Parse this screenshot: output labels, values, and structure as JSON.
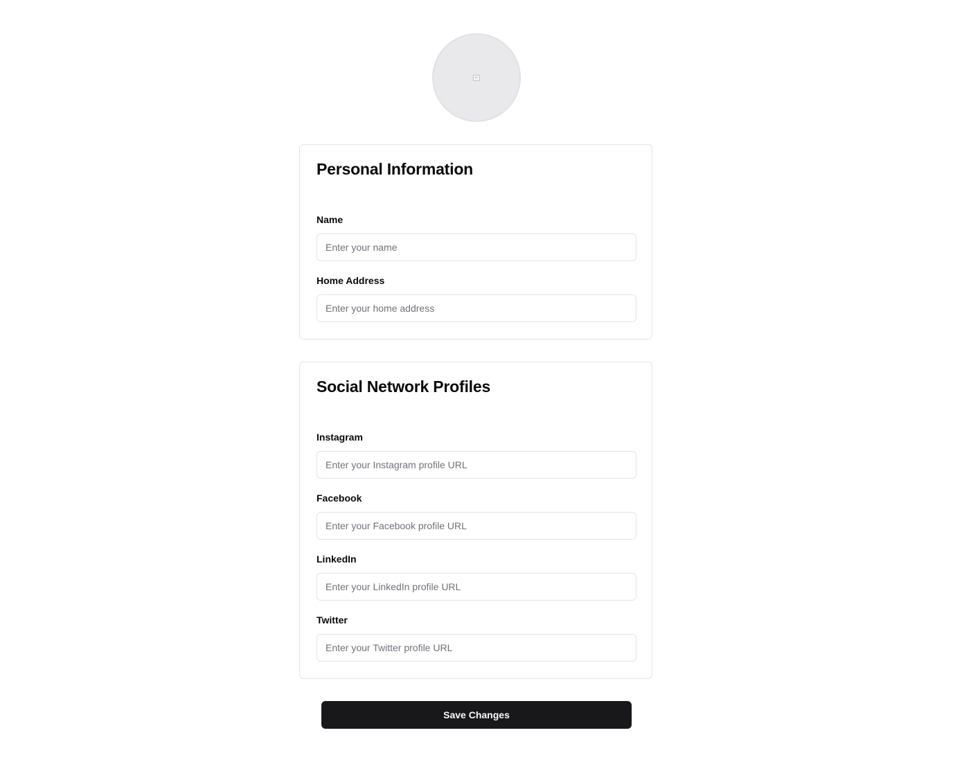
{
  "avatar": {
    "icon": "image-placeholder-icon"
  },
  "personal": {
    "title": "Personal Information",
    "fields": [
      {
        "label": "Name",
        "placeholder": "Enter your name",
        "value": ""
      },
      {
        "label": "Home Address",
        "placeholder": "Enter your home address",
        "value": ""
      }
    ]
  },
  "social": {
    "title": "Social Network Profiles",
    "fields": [
      {
        "label": "Instagram",
        "placeholder": "Enter your Instagram profile URL",
        "value": ""
      },
      {
        "label": "Facebook",
        "placeholder": "Enter your Facebook profile URL",
        "value": ""
      },
      {
        "label": "LinkedIn",
        "placeholder": "Enter your LinkedIn profile URL",
        "value": ""
      },
      {
        "label": "Twitter",
        "placeholder": "Enter your Twitter profile URL",
        "value": ""
      }
    ]
  },
  "actions": {
    "save_label": "Save Changes"
  },
  "colors": {
    "primary_button": "#18181b",
    "border": "#e4e4e7",
    "avatar_bg": "#e9e9eb",
    "placeholder": "#71717a"
  }
}
